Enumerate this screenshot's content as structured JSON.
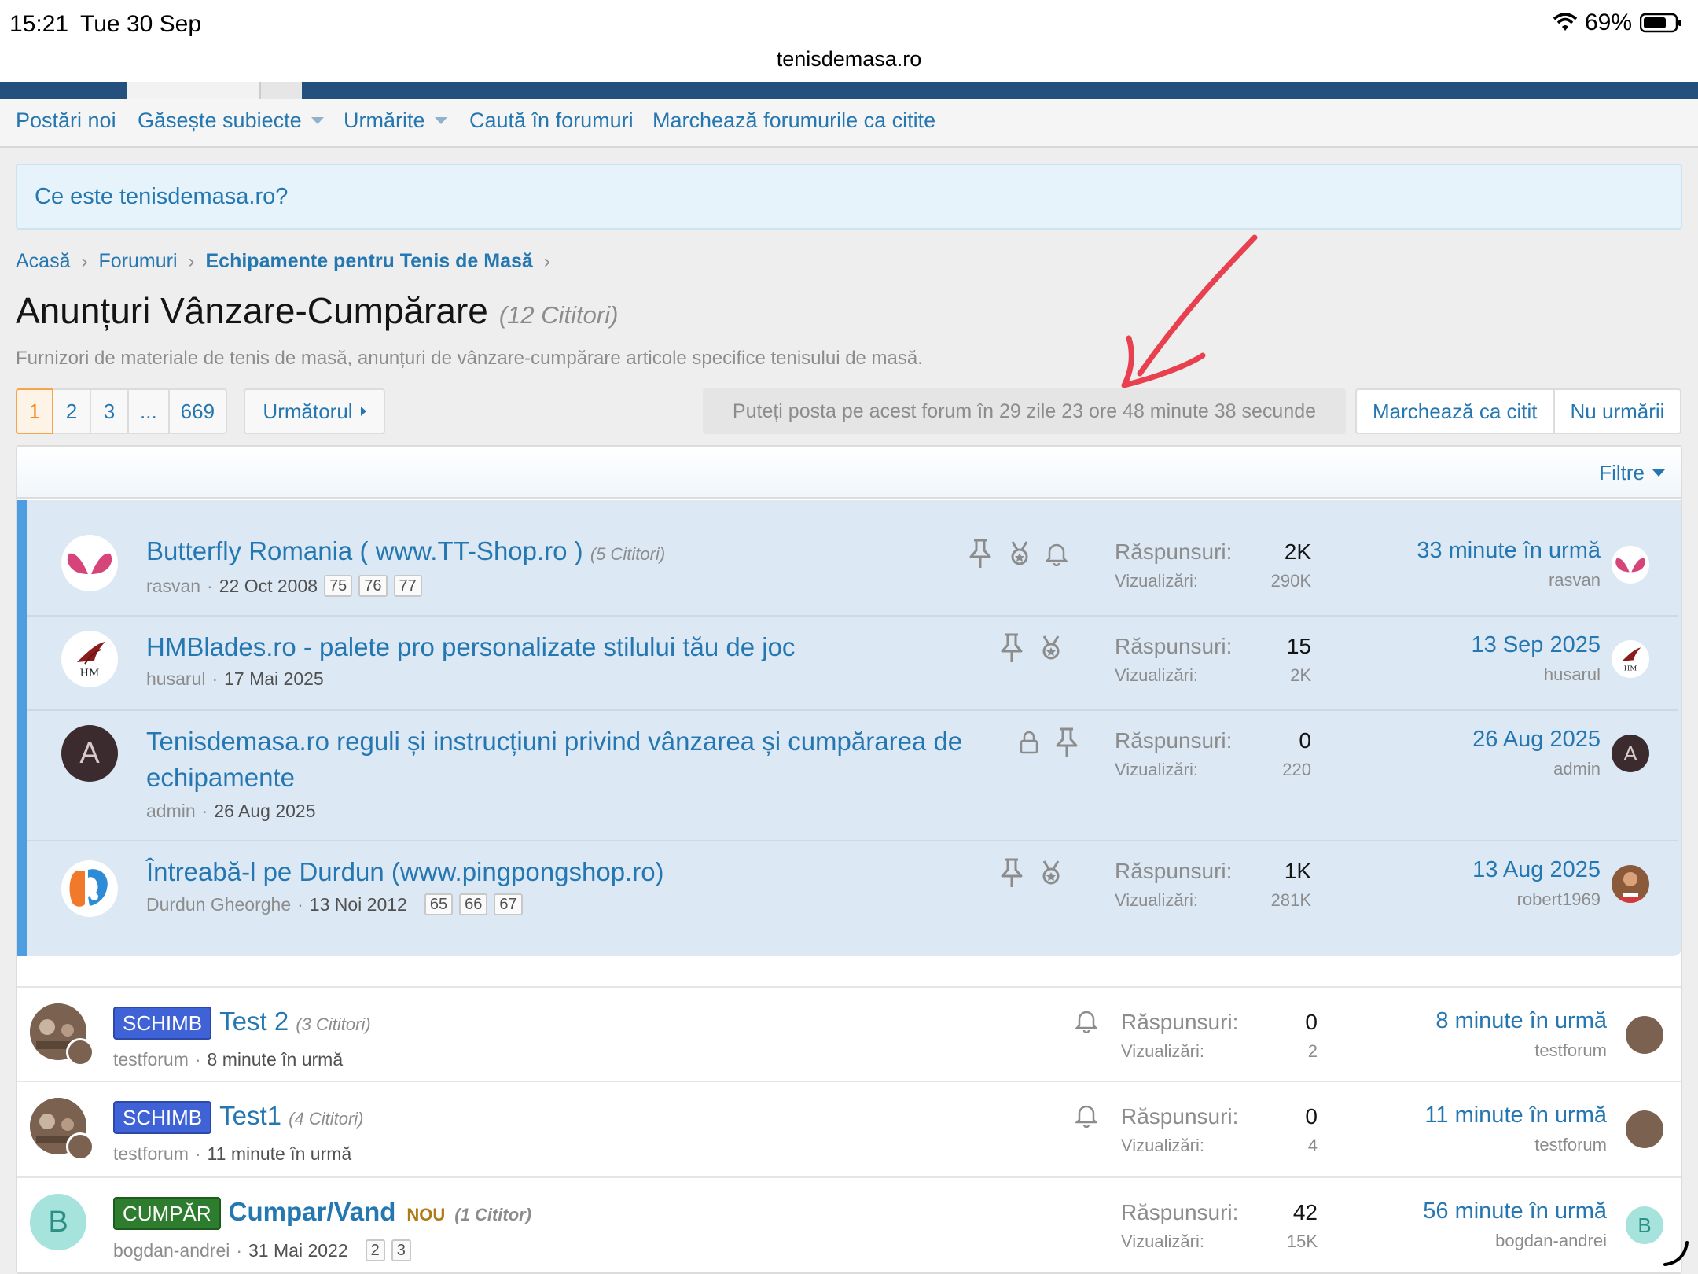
{
  "status_bar": {
    "time": "15:21",
    "date": "Tue 30 Sep",
    "battery": "69%",
    "url": "tenisdemasa.ro"
  },
  "subnav": {
    "items": [
      "Postări noi",
      "Găsește subiecte",
      "Urmărite",
      "Caută în forumuri",
      "Marchează forumurile ca citite"
    ]
  },
  "notice": "Ce este tenisdemasa.ro?",
  "breadcrumb": [
    "Acasă",
    "Forumuri",
    "Echipamente pentru Tenis de Masă"
  ],
  "page": {
    "title": "Anunțuri Vânzare-Cumpărare",
    "readers": "(12 Cititori)",
    "description": "Furnizori de materiale de tenis de masă, anunțuri de vânzare-cumpărare articole specifice tenisului de masă."
  },
  "pagination": {
    "pages": [
      "1",
      "2",
      "3",
      "...",
      "669"
    ],
    "next": "Următorul"
  },
  "post_info": "Puteți posta pe acest forum în 29 zile 23 ore 48 minute 38 secunde",
  "buttons": {
    "mark_read": "Marchează ca citit",
    "unwatch": "Nu urmării",
    "filters": "Filtre"
  },
  "labels": {
    "replies": "Răspunsuri:",
    "views": "Vizualizări:"
  },
  "sticky_threads": [
    {
      "title": "Butterfly Romania ( www.TT-Shop.ro )",
      "readers": "(5 Cititori)",
      "author": "rasvan",
      "date": "22 Oct 2008",
      "pages": [
        "75",
        "76",
        "77"
      ],
      "replies": "2K",
      "views": "290K",
      "last_time": "33 minute în urmă",
      "last_user": "rasvan"
    },
    {
      "title": "HMBlades.ro - palete pro personalizate stilului tău de joc",
      "readers": "",
      "author": "husarul",
      "date": "17 Mai 2025",
      "pages": [],
      "replies": "15",
      "views": "2K",
      "last_time": "13 Sep 2025",
      "last_user": "husarul"
    },
    {
      "title": "Tenisdemasa.ro reguli și instrucțiuni privind vânzarea și cumpărarea de echipamente",
      "readers": "",
      "author": "admin",
      "date": "26 Aug 2025",
      "pages": [],
      "replies": "0",
      "views": "220",
      "last_time": "26 Aug 2025",
      "last_user": "admin"
    },
    {
      "title": "Întreabă-l pe Durdun (www.pingpongshop.ro)",
      "readers": "",
      "author": "Durdun Gheorghe",
      "date": "13 Noi 2012",
      "pages": [
        "65",
        "66",
        "67"
      ],
      "replies": "1K",
      "views": "281K",
      "last_time": "13 Aug 2025",
      "last_user": "robert1969"
    }
  ],
  "threads": [
    {
      "prefix": "SCHIMB",
      "title": "Test 2",
      "readers": "(3 Cititori)",
      "author": "testforum",
      "date": "8 minute în urmă",
      "replies": "0",
      "views": "2",
      "last_time": "8 minute în urmă",
      "last_user": "testforum"
    },
    {
      "prefix": "SCHIMB",
      "title": "Test1",
      "readers": "(4 Cititori)",
      "author": "testforum",
      "date": "11 minute în urmă",
      "replies": "0",
      "views": "4",
      "last_time": "11 minute în urmă",
      "last_user": "testforum"
    },
    {
      "prefix": "CUMPĂR",
      "title": "Cumpar/Vand",
      "new_badge": "NOU",
      "readers": "(1 Cititor)",
      "author": "bogdan-andrei",
      "date": "31 Mai 2022",
      "pages": [
        "2",
        "3"
      ],
      "replies": "42",
      "views": "15K",
      "last_time": "56 minute în urmă",
      "last_user": "bogdan-andrei"
    }
  ],
  "avatar_letters": {
    "admin": "A",
    "bogdan": "B"
  },
  "colors": {
    "link": "#2577b1",
    "sticky_bg": "#dce9f5",
    "sticky_border": "#4d9de0",
    "annotation": "#e8404f",
    "prefix_blue": "#3f63d6",
    "prefix_green": "#2e7d2f"
  }
}
